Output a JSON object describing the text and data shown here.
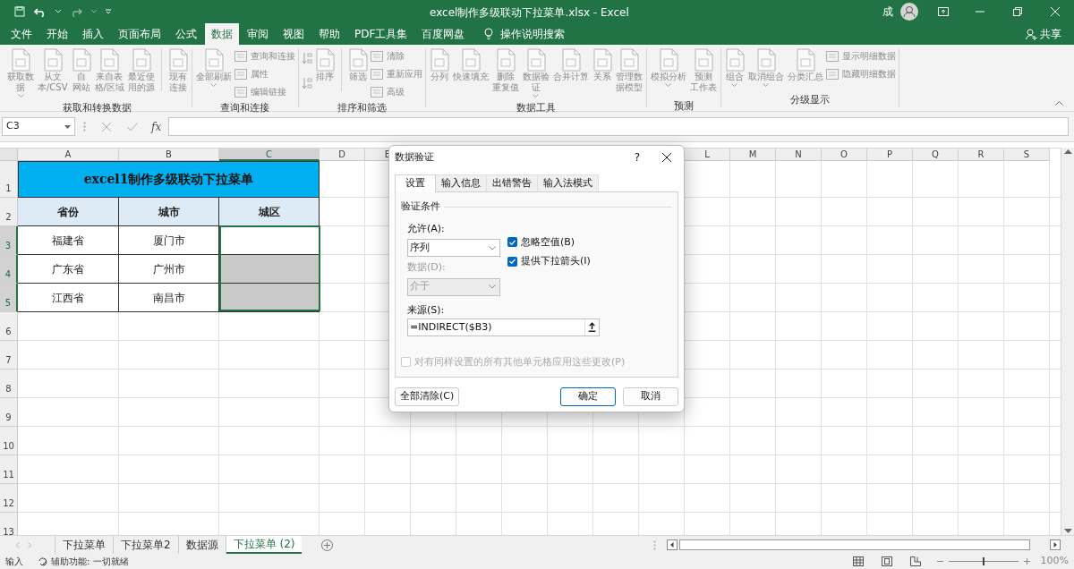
{
  "title_bar": {
    "title": "excel制作多级联动下拉菜单.xlsx  -  Excel",
    "user_initial": "成"
  },
  "menu_tabs": [
    {
      "label": "文件",
      "selected": false
    },
    {
      "label": "开始",
      "selected": false
    },
    {
      "label": "插入",
      "selected": false
    },
    {
      "label": "页面布局",
      "selected": false
    },
    {
      "label": "公式",
      "selected": false
    },
    {
      "label": "数据",
      "selected": true
    },
    {
      "label": "审阅",
      "selected": false
    },
    {
      "label": "视图",
      "selected": false
    },
    {
      "label": "帮助",
      "selected": false
    },
    {
      "label": "PDF工具集",
      "selected": false
    },
    {
      "label": "百度网盘",
      "selected": false
    }
  ],
  "tell_me": "操作说明搜索",
  "share": "共享",
  "ribbon_groups": [
    {
      "label": "获取和转换数据",
      "items": [
        {
          "kind": "large",
          "lines": [
            "获取数",
            "据"
          ],
          "dropdown": true
        },
        {
          "kind": "large",
          "lines": [
            "从文",
            "本/CSV"
          ],
          "dropdown": false
        },
        {
          "kind": "large",
          "lines": [
            "自",
            "网站"
          ],
          "dropdown": false
        },
        {
          "kind": "large",
          "lines": [
            "来自表",
            "格/区域"
          ],
          "dropdown": false
        },
        {
          "kind": "large",
          "lines": [
            "最近使",
            "用的源"
          ],
          "dropdown": false
        },
        {
          "kind": "separator"
        },
        {
          "kind": "large",
          "lines": [
            "现有",
            "连接"
          ],
          "dropdown": false
        }
      ]
    },
    {
      "label": "查询和连接",
      "items": [
        {
          "kind": "large",
          "lines": [
            "全部刷新"
          ],
          "dropdown": true
        },
        {
          "kind": "small",
          "labels": [
            "查询和连接",
            "属性",
            "编辑链接"
          ]
        }
      ]
    },
    {
      "label": "排序和筛选",
      "items": [
        {
          "kind": "sort"
        },
        {
          "kind": "large",
          "lines": [
            "排序"
          ],
          "dropdown": false
        },
        {
          "kind": "separator"
        },
        {
          "kind": "large",
          "lines": [
            "筛选"
          ],
          "dropdown": false
        },
        {
          "kind": "small",
          "labels": [
            "清除",
            "重新应用",
            "高级"
          ]
        }
      ]
    },
    {
      "label": "数据工具",
      "items": [
        {
          "kind": "large",
          "lines": [
            "分列"
          ],
          "dropdown": false
        },
        {
          "kind": "large",
          "lines": [
            "快速填充"
          ],
          "dropdown": false
        },
        {
          "kind": "large",
          "lines": [
            "删除",
            "重复值"
          ],
          "dropdown": false
        },
        {
          "kind": "large",
          "lines": [
            "数据验",
            "证"
          ],
          "dropdown": true
        },
        {
          "kind": "large",
          "lines": [
            "合并计算"
          ],
          "dropdown": false
        },
        {
          "kind": "large",
          "lines": [
            "关系"
          ],
          "dropdown": false
        },
        {
          "kind": "large",
          "lines": [
            "管理数",
            "据模型"
          ],
          "dropdown": false
        }
      ]
    },
    {
      "label": "预测",
      "items": [
        {
          "kind": "large",
          "lines": [
            "模拟分析"
          ],
          "dropdown": true
        },
        {
          "kind": "large",
          "lines": [
            "预测",
            "工作表"
          ],
          "dropdown": false
        }
      ]
    },
    {
      "label": "分级显示",
      "items": [
        {
          "kind": "large",
          "lines": [
            "组合"
          ],
          "dropdown": true
        },
        {
          "kind": "large",
          "lines": [
            "取消组合"
          ],
          "dropdown": true
        },
        {
          "kind": "large",
          "lines": [
            "分类汇总"
          ],
          "dropdown": false
        },
        {
          "kind": "small",
          "labels": [
            "显示明细数据",
            "隐藏明细数据"
          ]
        }
      ]
    }
  ],
  "formula_bar": {
    "name_box": "C3",
    "fx": "fx"
  },
  "sheet": {
    "columns": [
      {
        "label": "A",
        "selected": false
      },
      {
        "label": "B",
        "selected": false
      },
      {
        "label": "C",
        "selected": true
      },
      {
        "label": "D",
        "selected": false
      },
      {
        "label": "E",
        "selected": false
      },
      {
        "label": "L",
        "selected": false
      },
      {
        "label": "M",
        "selected": false
      },
      {
        "label": "N",
        "selected": false
      },
      {
        "label": "O",
        "selected": false
      },
      {
        "label": "P",
        "selected": false
      },
      {
        "label": "Q",
        "selected": false
      },
      {
        "label": "R",
        "selected": false
      },
      {
        "label": "S",
        "selected": false
      }
    ],
    "rows": [
      {
        "label": "1",
        "selected": false
      },
      {
        "label": "2",
        "selected": false
      },
      {
        "label": "3",
        "selected": true
      },
      {
        "label": "4",
        "selected": true
      },
      {
        "label": "5",
        "selected": true
      },
      {
        "label": "6",
        "selected": false
      },
      {
        "label": "7",
        "selected": false
      },
      {
        "label": "8",
        "selected": false
      },
      {
        "label": "9",
        "selected": false
      },
      {
        "label": "10",
        "selected": false
      },
      {
        "label": "11",
        "selected": false
      },
      {
        "label": "12",
        "selected": false
      },
      {
        "label": "13",
        "selected": false
      }
    ],
    "table_title": "excel1制作多级联动下拉菜单",
    "headers": [
      "省份",
      "城市",
      "城区"
    ],
    "records": [
      {
        "province": "福建省",
        "city": "厦门市",
        "district_shaded": false
      },
      {
        "province": "广东省",
        "city": "广州市",
        "district_shaded": true
      },
      {
        "province": "江西省",
        "city": "南昌市",
        "district_shaded": true
      }
    ]
  },
  "dialog": {
    "title": "数据验证",
    "help": "?",
    "tabs": [
      {
        "label": "设置",
        "selected": true
      },
      {
        "label": "输入信息",
        "selected": false
      },
      {
        "label": "出错警告",
        "selected": false
      },
      {
        "label": "输入法模式",
        "selected": false
      }
    ],
    "section": "验证条件",
    "allow_label": "允许(A):",
    "allow_value": "序列",
    "data_label": "数据(D):",
    "data_value": "介于",
    "data_disabled": true,
    "checks": [
      {
        "label": "忽略空值(B)",
        "checked": true
      },
      {
        "label": "提供下拉箭头(I)",
        "checked": true
      }
    ],
    "source_label": "来源(S):",
    "source_value": "=INDIRECT($B3)",
    "apply_all": {
      "label": "对有同样设置的所有其他单元格应用这些更改(P)",
      "checked": false,
      "disabled": true
    },
    "clear_button": "全部清除(C)",
    "ok_button": "确定",
    "cancel_button": "取消"
  },
  "sheet_tabs": [
    {
      "label": "下拉菜单",
      "selected": false
    },
    {
      "label": "下拉菜单2",
      "selected": false
    },
    {
      "label": "数据源",
      "selected": false
    },
    {
      "label": "下拉菜单 (2)",
      "selected": true
    }
  ],
  "status_bar": {
    "mode": "输入",
    "accessibility": "辅助功能: 一切就绪",
    "zoom": "100%",
    "level": 0.5
  }
}
